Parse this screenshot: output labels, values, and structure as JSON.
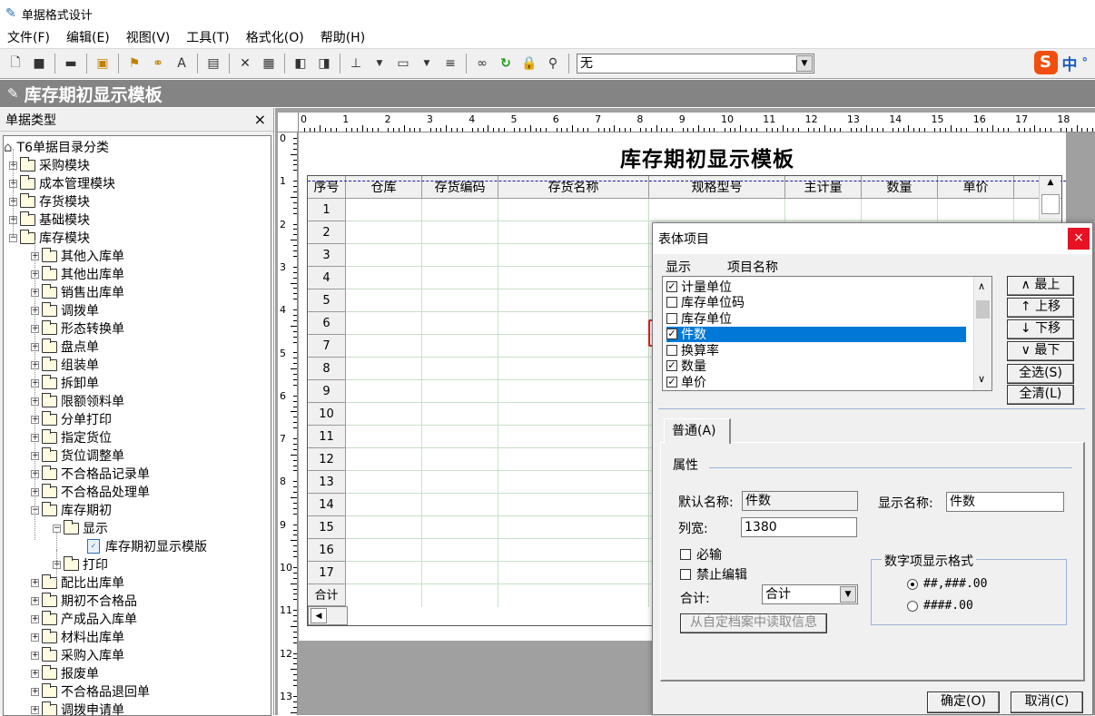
{
  "app": {
    "title": "单据格式设计"
  },
  "menu": [
    "文件(F)",
    "编辑(E)",
    "视图(V)",
    "工具(T)",
    "格式化(O)",
    "帮助(H)"
  ],
  "toolbar": {
    "combo_value": "无",
    "ime_logo": "S",
    "ime_lang": "中",
    "ime_punct": "°"
  },
  "banner": {
    "title": "库存期初显示模板"
  },
  "left_panel": {
    "title": "单据类型",
    "close": "×",
    "tree": [
      {
        "label": "T6单据目录分类",
        "level": 0,
        "toggle": "",
        "kind": "root"
      },
      {
        "label": "采购模块",
        "level": 1,
        "toggle": "+"
      },
      {
        "label": "成本管理模块",
        "level": 1,
        "toggle": "+"
      },
      {
        "label": "存货模块",
        "level": 1,
        "toggle": "+"
      },
      {
        "label": "基础模块",
        "level": 1,
        "toggle": "+"
      },
      {
        "label": "库存模块",
        "level": 1,
        "toggle": "−"
      },
      {
        "label": "其他入库单",
        "level": 2,
        "toggle": "+"
      },
      {
        "label": "其他出库单",
        "level": 2,
        "toggle": "+"
      },
      {
        "label": "销售出库单",
        "level": 2,
        "toggle": "+"
      },
      {
        "label": "调拨单",
        "level": 2,
        "toggle": "+"
      },
      {
        "label": "形态转换单",
        "level": 2,
        "toggle": "+"
      },
      {
        "label": "盘点单",
        "level": 2,
        "toggle": "+"
      },
      {
        "label": "组装单",
        "level": 2,
        "toggle": "+"
      },
      {
        "label": "拆卸单",
        "level": 2,
        "toggle": "+"
      },
      {
        "label": "限额领料单",
        "level": 2,
        "toggle": "+"
      },
      {
        "label": "分单打印",
        "level": 2,
        "toggle": "+"
      },
      {
        "label": "指定货位",
        "level": 2,
        "toggle": "+"
      },
      {
        "label": "货位调整单",
        "level": 2,
        "toggle": "+"
      },
      {
        "label": "不合格品记录单",
        "level": 2,
        "toggle": "+"
      },
      {
        "label": "不合格品处理单",
        "level": 2,
        "toggle": "+"
      },
      {
        "label": "库存期初",
        "level": 2,
        "toggle": "−"
      },
      {
        "label": "显示",
        "level": 3,
        "toggle": "−"
      },
      {
        "label": "库存期初显示模版",
        "level": 4,
        "toggle": "",
        "kind": "doc"
      },
      {
        "label": "打印",
        "level": 3,
        "toggle": "+"
      },
      {
        "label": "配比出库单",
        "level": 2,
        "toggle": "+"
      },
      {
        "label": "期初不合格品",
        "level": 2,
        "toggle": "+"
      },
      {
        "label": "产成品入库单",
        "level": 2,
        "toggle": "+"
      },
      {
        "label": "材料出库单",
        "level": 2,
        "toggle": "+"
      },
      {
        "label": "采购入库单",
        "level": 2,
        "toggle": "+"
      },
      {
        "label": "报废单",
        "level": 2,
        "toggle": "+"
      },
      {
        "label": "不合格品退回单",
        "level": 2,
        "toggle": "+"
      },
      {
        "label": "调拨申请单",
        "level": 2,
        "toggle": "+"
      }
    ]
  },
  "ruler": {
    "h": [
      "0",
      "1",
      "2",
      "3",
      "4",
      "5",
      "6",
      "7",
      "8",
      "9",
      "10",
      "11",
      "12",
      "13",
      "14",
      "15",
      "16",
      "17",
      "18"
    ],
    "v": [
      "0",
      "1",
      "2",
      "3",
      "4",
      "5",
      "6",
      "7",
      "8",
      "9",
      "10",
      "11",
      "12",
      "13"
    ]
  },
  "document": {
    "title": "库存期初显示模板",
    "columns": [
      "序号",
      "仓库",
      "存货编码",
      "存货名称",
      "规格型号",
      "主计量",
      "数量",
      "单价"
    ],
    "rows": [
      "1",
      "2",
      "3",
      "4",
      "5",
      "6",
      "7",
      "8",
      "9",
      "10",
      "11",
      "12",
      "13",
      "14",
      "15",
      "16",
      "17"
    ],
    "total_label": "合计"
  },
  "dialog": {
    "title": "表体项目",
    "close": "×",
    "col_show": "显示",
    "col_name": "项目名称",
    "items": [
      {
        "label": "计量单位",
        "checked": true,
        "selected": false
      },
      {
        "label": "库存单位码",
        "checked": false,
        "selected": false
      },
      {
        "label": "库存单位",
        "checked": false,
        "selected": false
      },
      {
        "label": "件数",
        "checked": true,
        "selected": true
      },
      {
        "label": "换算率",
        "checked": false,
        "selected": false
      },
      {
        "label": "数量",
        "checked": true,
        "selected": false
      },
      {
        "label": "单价",
        "checked": true,
        "selected": false
      }
    ],
    "buttons": {
      "top": "∧ 最上",
      "up": "↑ 上移",
      "down": "↓ 下移",
      "bottom": "∨ 最下",
      "select_all": "全选(S)",
      "clear_all": "全清(L)"
    },
    "tab": "普通(A)",
    "group_props": "属性",
    "default_name_label": "默认名称:",
    "default_name": "件数",
    "display_name_label": "显示名称:",
    "display_name": "件数",
    "width_label": "列宽:",
    "width": "1380",
    "required": {
      "label": "必输",
      "checked": false
    },
    "no_edit": {
      "label": "禁止编辑",
      "checked": false
    },
    "sum_label": "合计:",
    "sum_value": "合计",
    "read_btn": "从自定档案中读取信息",
    "numfmt_title": "数字项显示格式",
    "numfmt": [
      {
        "label": "##,###.00",
        "checked": true
      },
      {
        "label": "####.00",
        "checked": false
      }
    ],
    "ok": "确定(O)",
    "cancel": "取消(C)"
  }
}
